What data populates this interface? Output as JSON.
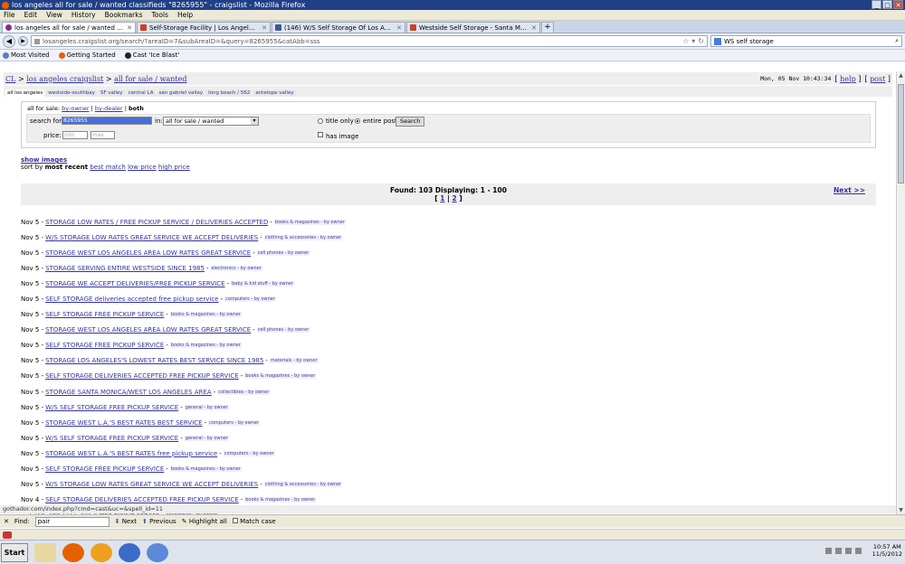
{
  "window": {
    "title": "los angeles all for sale / wanted classifieds \"8265955\" - craigslist - Mozilla Firefox",
    "buttons": [
      "_",
      "□",
      "✕"
    ]
  },
  "menu": [
    "File",
    "Edit",
    "View",
    "History",
    "Bookmarks",
    "Tools",
    "Help"
  ],
  "tabs": [
    {
      "label": "los angeles all for sale / wanted classified...",
      "active": true
    },
    {
      "label": "Self-Storage Facility | Los Angeles, CA",
      "active": false
    },
    {
      "label": "(146) W/S Self Storage Of Los Angeles",
      "active": false
    },
    {
      "label": "Westside Self Storage - Santa Monica - L...",
      "active": false
    }
  ],
  "nav": {
    "url": "losangeles.craigslist.org/search/?areaID=7&subAreaID=&query=8265955&catAbb=sss",
    "search_query": "WS self storage"
  },
  "bookmarks": [
    "Most Visited",
    "Getting Started",
    "Cast 'Ice Blast'"
  ],
  "page": {
    "breadcrumb": {
      "cl": "CL",
      "sep1": ">",
      "city": "los angeles craigslist",
      "sep2": ">",
      "section": "all for sale / wanted"
    },
    "date": "Mon, 05 Nov 10:43:34",
    "help": "help",
    "post": "post",
    "subnav": [
      "all los angeles",
      "westside-southbay",
      "SF valley",
      "central LA",
      "san gabriel valley",
      "long beach / 562",
      "antelope valley"
    ],
    "forsale": {
      "prefix": "all for sale:",
      "byowner": "by-owner",
      "bydealer": "by-dealer",
      "both": "both"
    },
    "search": {
      "search_for_label": "search for:",
      "query_value": "8265955",
      "in_label": "in:",
      "category_value": "all for sale / wanted",
      "title_only_label": "title only",
      "entire_post_label": "entire post",
      "search_button": "Search",
      "price_label": "price:",
      "min_placeholder": "min",
      "max_placeholder": "max",
      "has_image_label": "has image"
    },
    "show_images": "show images",
    "sort": {
      "prefix": "sort by",
      "current": "most recent",
      "best": "best match",
      "low": "low price",
      "high": "high price"
    },
    "results": {
      "found": "Found: 103 Displaying: 1 - 100",
      "page1": "1",
      "page2": "2",
      "next": "Next >>"
    },
    "listings": [
      {
        "date": "Nov 5 -",
        "title": "STORAGE LOW RATES / FREE PICKUP SERVICE / DELIVERIES ACCEPTED",
        "cat": "books & magazines - by owner"
      },
      {
        "date": "Nov 5 -",
        "title": "W/S STORAGE LOW RATES GREAT SERVICE WE ACCEPT DELIVERIES",
        "cat": "clothing & accessories - by owner"
      },
      {
        "date": "Nov 5 -",
        "title": "STORAGE WEST LOS ANGELES AREA LOW RATES GREAT SERVICE",
        "cat": "cell phones - by owner"
      },
      {
        "date": "Nov 5 -",
        "title": "STORAGE SERVING ENTIRE WESTSIDE SINCE 1985",
        "cat": "electronics - by owner"
      },
      {
        "date": "Nov 5 -",
        "title": "STORAGE WE ACCEPT DELIVERIES/FREE PICKUP SERVICE",
        "cat": "baby & kid stuff - by owner"
      },
      {
        "date": "Nov 5 -",
        "title": "SELF STORAGE deliveries accepted free pickup service",
        "cat": "computers - by owner"
      },
      {
        "date": "Nov 5 -",
        "title": "SELF STORAGE FREE PICKUP SERVICE",
        "cat": "books & magazines - by owner"
      },
      {
        "date": "Nov 5 -",
        "title": "STORAGE WEST LOS ANGELES AREA LOW RATES GREAT SERVICE",
        "cat": "cell phones - by owner"
      },
      {
        "date": "Nov 5 -",
        "title": "SELF STORAGE FREE PICKUP SERVICE",
        "cat": "books & magazines - by owner"
      },
      {
        "date": "Nov 5 -",
        "title": "STORAGE LOS ANGELES'S LOWEST RATES BEST SERVICE SINCE 1985",
        "cat": "materials - by owner"
      },
      {
        "date": "Nov 5 -",
        "title": "SELF STORAGE DELIVERIES ACCEPTED FREE PICKUP SERVICE",
        "cat": "books & magazines - by owner"
      },
      {
        "date": "Nov 5 -",
        "title": "STORAGE SANTA MONICA/WEST LOS ANGELES AREA",
        "cat": "collectibles - by owner"
      },
      {
        "date": "Nov 5 -",
        "title": "W/S SELF STORAGE FREE PICKUP SERVICE",
        "cat": "general - by owner"
      },
      {
        "date": "Nov 5 -",
        "title": "STORAGE WEST L.A.'S BEST RATES BEST SERVICE",
        "cat": "computers - by owner"
      },
      {
        "date": "Nov 5 -",
        "title": "W/S SELF STORAGE FREE PICKUP SERVICE",
        "cat": "general - by owner"
      },
      {
        "date": "Nov 5 -",
        "title": "STORAGE WEST L.A.'S BEST RATES free pickup service",
        "cat": "computers - by owner"
      },
      {
        "date": "Nov 5 -",
        "title": "SELF STORAGE FREE PICKUP SERVICE",
        "cat": "books & magazines - by owner"
      },
      {
        "date": "Nov 5 -",
        "title": "W/S STORAGE LOW RATES GREAT SERVICE WE ACCEPT DELIVERIES",
        "cat": "clothing & accessories - by owner"
      },
      {
        "date": "Nov 4 -",
        "title": "SELF STORAGE DELIVERIES ACCEPTED FREE PICKUP SERVICE",
        "cat": "books & magazines - by owner"
      },
      {
        "date": "",
        "title": "...T LOS ANGELES AREA free pickup service",
        "cat": "collectibles - by owner"
      }
    ]
  },
  "status_url": "gothador.com/index.php?cmd=cast&uc=&spell_id=11",
  "find": {
    "label": "Find:",
    "value": "pair",
    "next": "Next",
    "previous": "Previous",
    "highlight": "Highlight all",
    "match_case": "Match case"
  },
  "taskbar": {
    "start": "Start",
    "time": "10:57 AM",
    "date": "11/5/2012"
  }
}
